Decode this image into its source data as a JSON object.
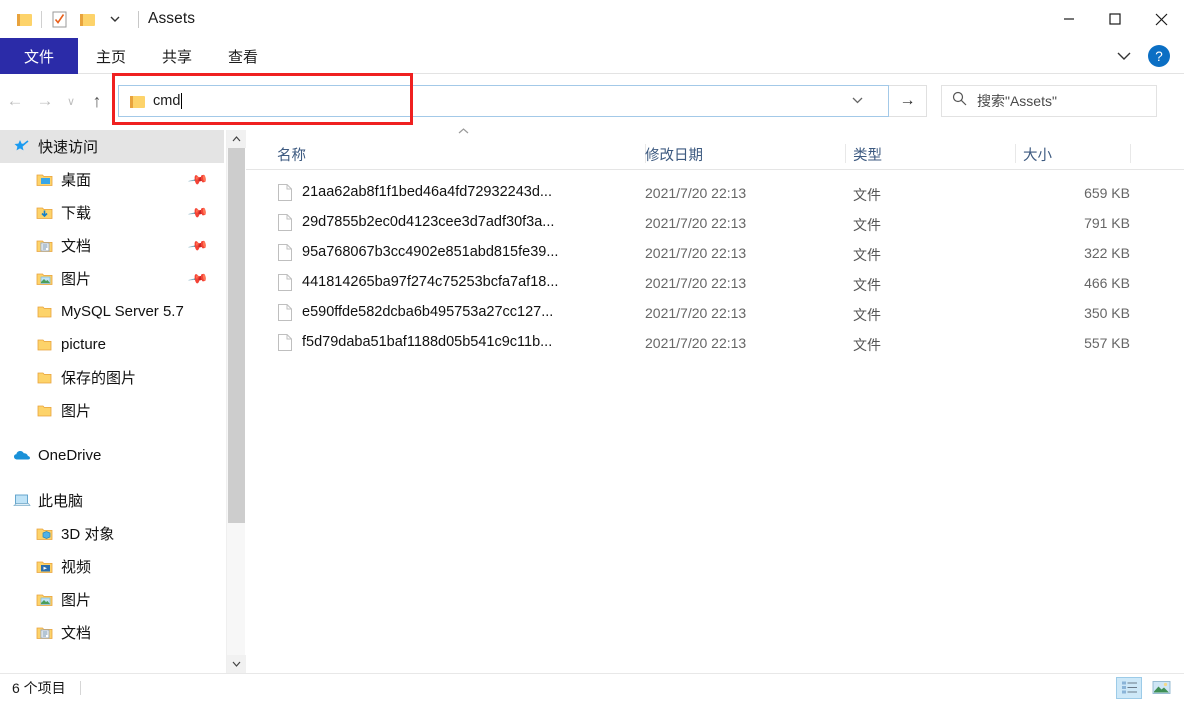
{
  "window": {
    "title": "Assets",
    "quick_access_toolbar": [
      {
        "name": "folder-icon",
        "label": "属性"
      },
      {
        "name": "properties-icon",
        "label": "属性"
      },
      {
        "name": "new-folder-icon",
        "label": "新建文件夹"
      },
      {
        "name": "chevron-down-icon",
        "label": "自定义快速访问工具栏"
      }
    ],
    "controls": {
      "minimize": "—",
      "maximize": "☐",
      "close": "✕"
    }
  },
  "ribbon": {
    "tabs": [
      {
        "label": "文件",
        "active": true
      },
      {
        "label": "主页",
        "active": false
      },
      {
        "label": "共享",
        "active": false
      },
      {
        "label": "查看",
        "active": false
      }
    ],
    "expand_icon": "chevron-down-icon",
    "help_label": "?"
  },
  "navigation": {
    "back_icon": "←",
    "forward_icon": "→",
    "recent_icon": "∨",
    "up_icon": "↑",
    "go_icon": "→"
  },
  "address_bar": {
    "value": "cmd",
    "folder_icon": "folder-icon",
    "dropdown_icon": "∨",
    "highlight_color": "#ef2020"
  },
  "search": {
    "placeholder": "搜索\"Assets\"",
    "icon": "search-icon"
  },
  "sidebar": {
    "groups": [
      {
        "name": "快速访问",
        "icon": "star-pin-icon",
        "selected": true,
        "items": [
          {
            "label": "桌面",
            "icon": "desktop-folder-icon",
            "pinned": true
          },
          {
            "label": "下载",
            "icon": "downloads-folder-icon",
            "pinned": true
          },
          {
            "label": "文档",
            "icon": "documents-folder-icon",
            "pinned": true
          },
          {
            "label": "图片",
            "icon": "pictures-folder-icon",
            "pinned": true
          },
          {
            "label": "MySQL Server 5.7",
            "icon": "folder-icon",
            "pinned": false
          },
          {
            "label": "picture",
            "icon": "folder-icon",
            "pinned": false
          },
          {
            "label": "保存的图片",
            "icon": "folder-icon",
            "pinned": false
          },
          {
            "label": "图片",
            "icon": "folder-icon",
            "pinned": false
          }
        ]
      },
      {
        "name": "OneDrive",
        "icon": "onedrive-cloud-icon",
        "selected": false,
        "items": []
      },
      {
        "name": "此电脑",
        "icon": "this-pc-icon",
        "selected": false,
        "items": [
          {
            "label": "3D 对象",
            "icon": "3d-objects-folder-icon",
            "pinned": false
          },
          {
            "label": "视频",
            "icon": "videos-folder-icon",
            "pinned": false
          },
          {
            "label": "图片",
            "icon": "pictures-folder-icon",
            "pinned": false
          },
          {
            "label": "文档",
            "icon": "documents-folder-icon",
            "pinned": false
          }
        ]
      }
    ],
    "scroll_up_icon": "⌃",
    "scroll_down_icon": "⌄"
  },
  "file_list": {
    "sort_indicator": "⌃",
    "columns": [
      {
        "label": "名称",
        "key": "name"
      },
      {
        "label": "修改日期",
        "key": "date"
      },
      {
        "label": "类型",
        "key": "type"
      },
      {
        "label": "大小",
        "key": "size"
      }
    ],
    "rows": [
      {
        "name": "21aa62ab8f1f1bed46a4fd72932243d...",
        "date": "2021/7/20 22:13",
        "type": "文件",
        "size": "659 KB"
      },
      {
        "name": "29d7855b2ec0d4123cee3d7adf30f3a...",
        "date": "2021/7/20 22:13",
        "type": "文件",
        "size": "791 KB"
      },
      {
        "name": "95a768067b3cc4902e851abd815fe39...",
        "date": "2021/7/20 22:13",
        "type": "文件",
        "size": "322 KB"
      },
      {
        "name": "441814265ba97f274c75253bcfa7af18...",
        "date": "2021/7/20 22:13",
        "type": "文件",
        "size": "466 KB"
      },
      {
        "name": "e590ffde582dcba6b495753a27cc127...",
        "date": "2021/7/20 22:13",
        "type": "文件",
        "size": "350 KB"
      },
      {
        "name": "f5d79daba51baf1188d05b541c9c11b...",
        "date": "2021/7/20 22:13",
        "type": "文件",
        "size": "557 KB"
      }
    ]
  },
  "status_bar": {
    "item_count": "6 个项目",
    "view_buttons": [
      {
        "name": "details-view-button",
        "active": true
      },
      {
        "name": "large-icons-view-button",
        "active": false
      }
    ]
  }
}
